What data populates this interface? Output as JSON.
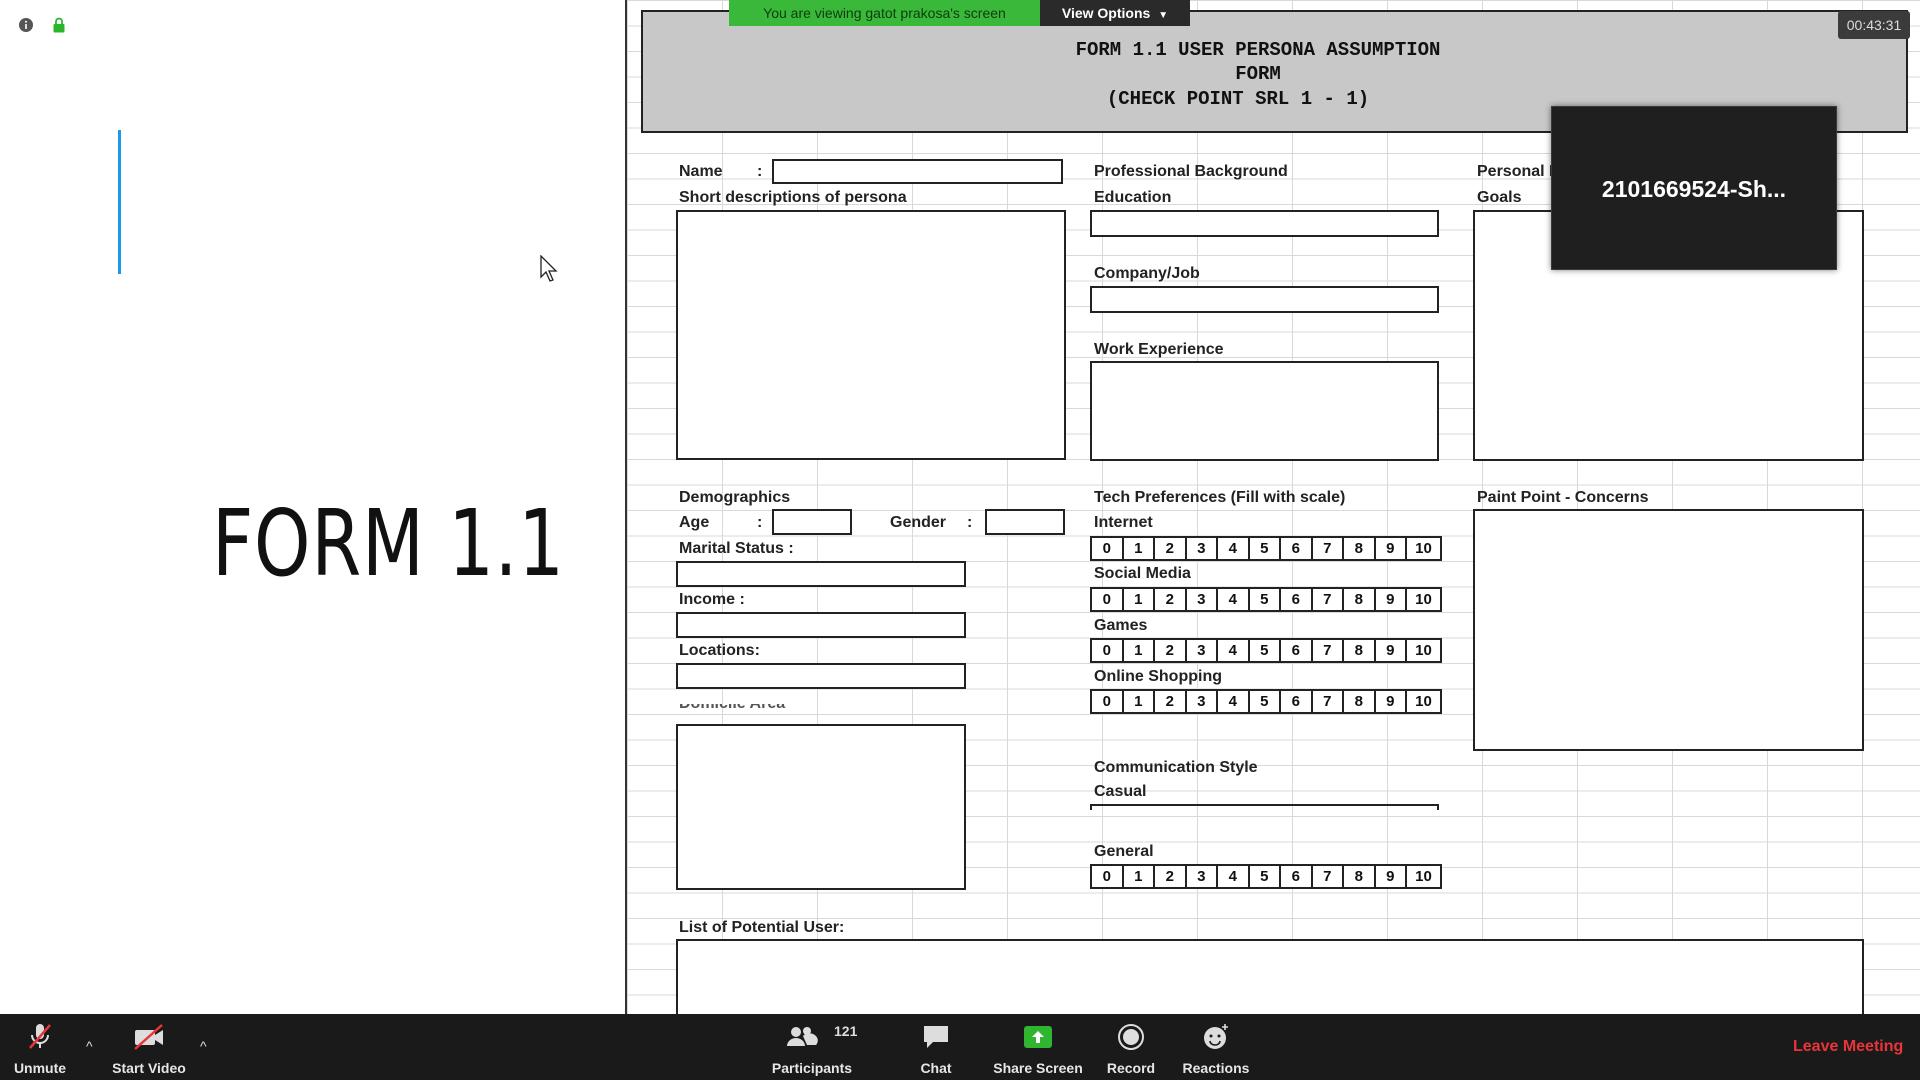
{
  "meeting": {
    "banner": "You are viewing gatot prakosa's screen",
    "view_options": "View Options",
    "timer": "00:43:31",
    "video_tile_name": "2101669524-Sh...",
    "status_icons": [
      "info-icon",
      "lock-icon"
    ]
  },
  "slide": {
    "title": "FORM 1.1"
  },
  "form": {
    "title_line1": "FORM 1.1 USER PERSONA ASSUMPTION",
    "title_line2": "FORM",
    "title_line3": "(CHECK POINT SRL 1 - 1)",
    "name_label": "Name",
    "colon": ":",
    "short_desc_label": "Short descriptions of persona",
    "professional_bg_label": "Professional Background",
    "education_label": "Education",
    "company_label": "Company/Job",
    "work_exp_label": "Work Experience",
    "personal_label": "Personal F",
    "goals_label": "Goals",
    "demographics_label": "Demographics",
    "age_label": "Age",
    "gender_label": "Gender",
    "marital_label": "Marital Status :",
    "income_label": "Income :",
    "locations_label": "Locations:",
    "hidden_label": "Domicile Area",
    "tech_pref_label": "Tech Preferences (Fill with scale)",
    "internet_label": "Internet",
    "social_label": "Social Media",
    "games_label": "Games",
    "shopping_label": "Online Shopping",
    "comm_style_label": "Communication Style",
    "casual_label": "Casual",
    "general_label": "General",
    "pain_point_label": "Paint Point - Concerns",
    "potential_users_label": "List of Potential User:",
    "scale": [
      "0",
      "1",
      "2",
      "3",
      "4",
      "5",
      "6",
      "7",
      "8",
      "9",
      "10"
    ]
  },
  "toolbar": {
    "unmute": "Unmute",
    "start_video": "Start Video",
    "participants": "Participants",
    "participants_count": "121",
    "chat": "Chat",
    "share_screen": "Share Screen",
    "record": "Record",
    "reactions": "Reactions",
    "leave": "Leave Meeting",
    "colors": {
      "leave": "#e8343a",
      "share": "#2fb52f",
      "banner": "#3ab83a"
    }
  }
}
